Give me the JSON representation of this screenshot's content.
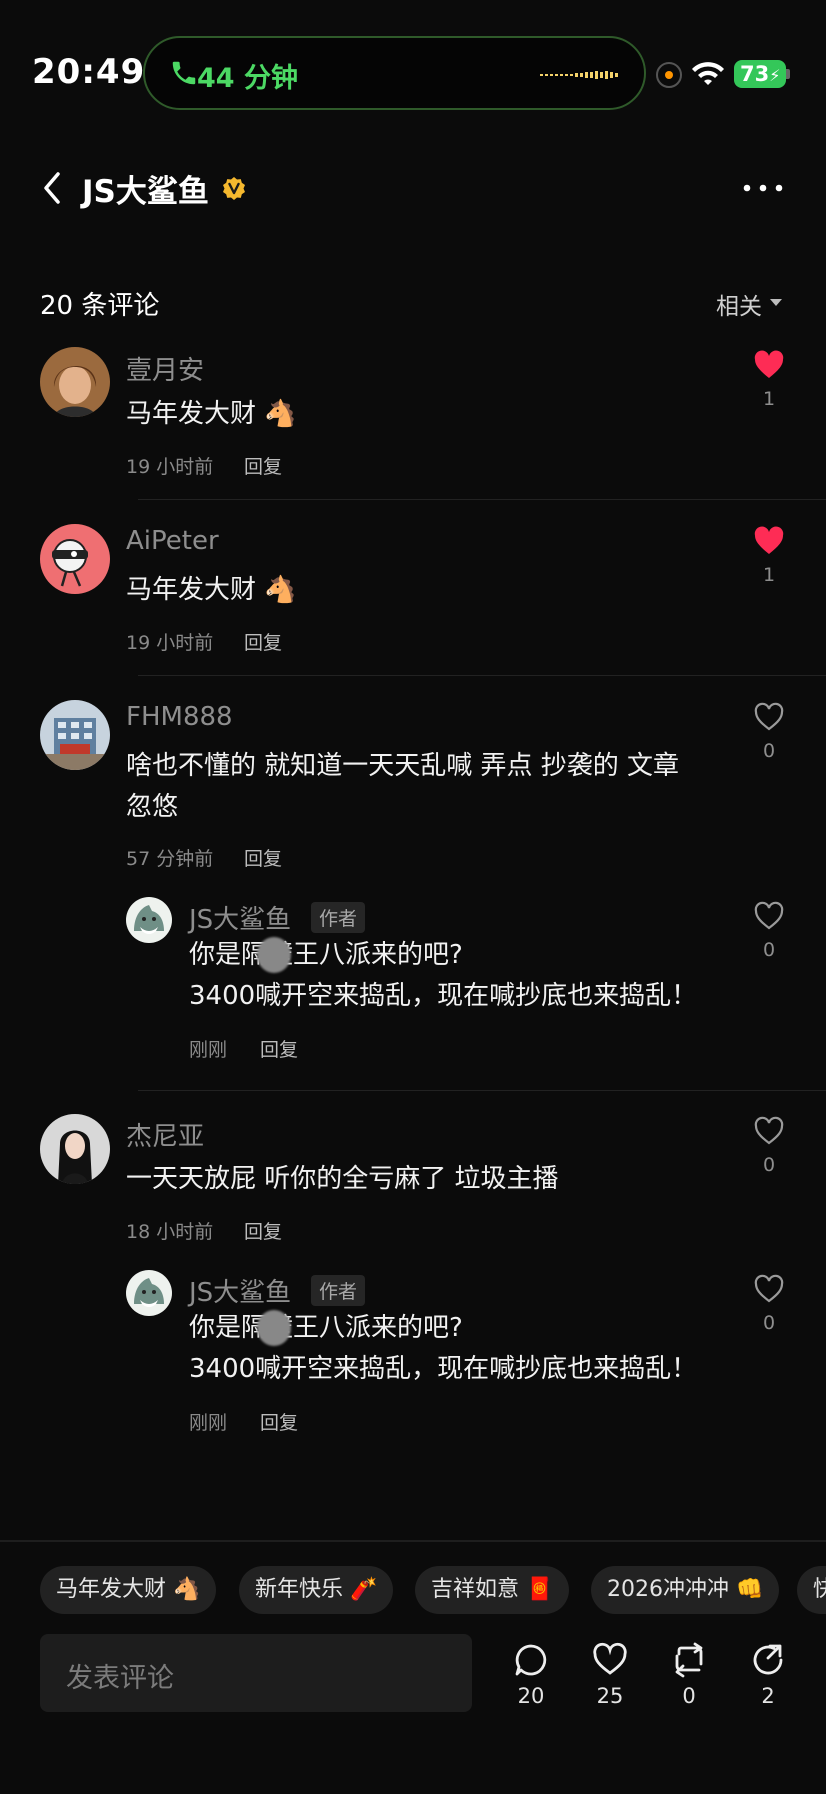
{
  "status_bar": {
    "time": "20:49",
    "call_duration": "44 分钟",
    "battery": "73"
  },
  "header": {
    "title": "JS大鲨鱼"
  },
  "comments_header": {
    "count": "20 条评论",
    "sort": "相关"
  },
  "comments": [
    {
      "user": "壹月安",
      "text": "马年发大财 🐴",
      "time": "19 小时前",
      "reply": "回复",
      "likes": "1",
      "liked": true
    },
    {
      "user": "AiPeter",
      "text": "马年发大财 🐴",
      "time": "19 小时前",
      "reply": "回复",
      "likes": "1",
      "liked": true
    },
    {
      "user": "FHM888",
      "text_line1": "啥也不懂的 就知道一天天乱喊   弄点 抄袭的 文章",
      "text_line2": "忽悠",
      "time": "57 分钟前",
      "reply": "回复",
      "likes": "0",
      "liked": false
    },
    {
      "user": "杰尼亚",
      "text": "一天天放屁 听你的全亏麻了 垃圾主播",
      "time": "18 小时前",
      "reply": "回复",
      "likes": "0",
      "liked": false
    }
  ],
  "author_reply": {
    "user": "JS大鲨鱼",
    "tag": "作者",
    "line1_a": "你是隔",
    "line1_b": "壁王八派来的吧?",
    "line2": "3400喊开空来捣乱，现在喊抄底也来捣乱！",
    "time": "刚刚",
    "reply": "回复",
    "likes": "0"
  },
  "quick_chips": [
    "马年发大财 🐴",
    "新年快乐 🧨",
    "吉祥如意 🧧",
    "2026冲冲冲 👊",
    "快"
  ],
  "composer": {
    "placeholder": "发表评论"
  },
  "actions": {
    "comments": "20",
    "likes": "25",
    "reposts": "0",
    "shares": "2"
  },
  "colors": {
    "accent_like": "#fe2c55",
    "call_green": "#4cd964",
    "battery_green": "#34c759",
    "verified": "#f5b82e"
  }
}
